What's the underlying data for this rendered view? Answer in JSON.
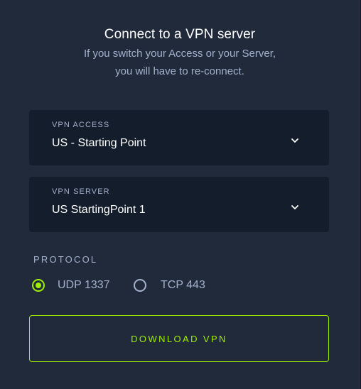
{
  "header": {
    "title": "Connect to a VPN server",
    "subtitle_line1": "If you switch your Access or your Server,",
    "subtitle_line2": "you will have to re-connect."
  },
  "vpn_access": {
    "label": "VPN ACCESS",
    "value": "US - Starting Point",
    "icon": "chevron-down-icon"
  },
  "vpn_server": {
    "label": "VPN SERVER",
    "value": "US StartingPoint 1",
    "icon": "chevron-down-icon"
  },
  "protocol": {
    "label": "PROTOCOL",
    "options": [
      {
        "label": "UDP 1337",
        "selected": true
      },
      {
        "label": "TCP 443",
        "selected": false
      }
    ]
  },
  "download_button": {
    "label": "DOWNLOAD VPN"
  },
  "colors": {
    "panel_bg": "#202a3b",
    "field_bg": "#141d2b",
    "accent": "#9fef00",
    "muted_text": "#a4b1cd"
  }
}
